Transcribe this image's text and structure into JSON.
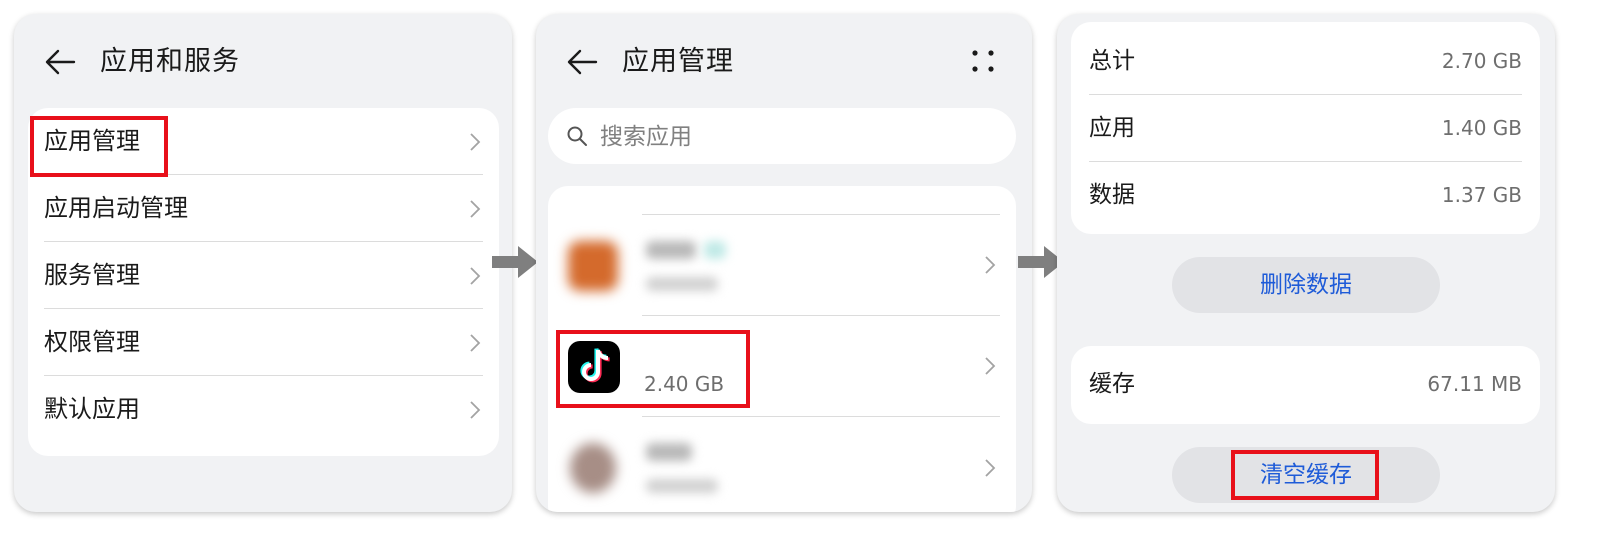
{
  "panel1": {
    "title": "应用和服务",
    "items": [
      {
        "label": "应用管理"
      },
      {
        "label": "应用启动管理"
      },
      {
        "label": "服务管理"
      },
      {
        "label": "权限管理"
      },
      {
        "label": "默认应用"
      }
    ]
  },
  "panel2": {
    "title": "应用管理",
    "search_placeholder": "搜索应用",
    "selected_app": {
      "name": "",
      "size": "2.40 GB",
      "icon": "tiktok-icon"
    }
  },
  "panel3": {
    "stats": [
      {
        "label": "总计",
        "value": "2.70 GB"
      },
      {
        "label": "应用",
        "value": "1.40 GB"
      },
      {
        "label": "数据",
        "value": "1.37 GB"
      }
    ],
    "delete_data_label": "删除数据",
    "cache": {
      "label": "缓存",
      "value": "67.11 MB"
    },
    "clear_cache_label": "清空缓存"
  },
  "colors": {
    "highlight": "#e8101a",
    "accent": "#1e5bd8",
    "panel_bg": "#f1f2f4",
    "arrow": "#7f7f7f"
  }
}
